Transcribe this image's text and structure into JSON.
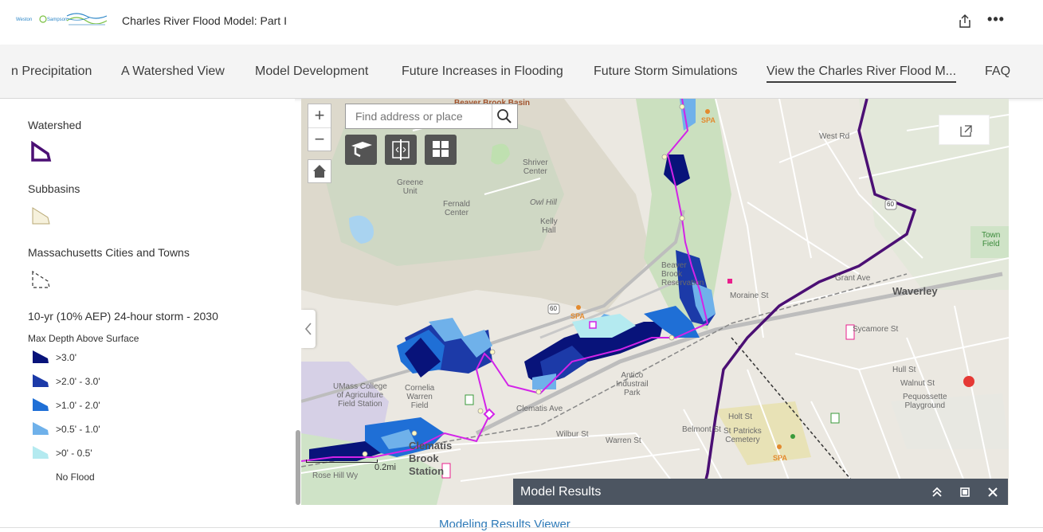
{
  "header": {
    "title": "Charles River Flood Model: Part I",
    "more_label": "•••"
  },
  "nav": {
    "items": [
      "n Precipitation",
      "A Watershed View",
      "Model Development",
      "Future Increases in Flooding",
      "Future Storm Simulations",
      "View the Charles River Flood M...",
      "FAQ"
    ],
    "active_index": 5
  },
  "legend": {
    "watershed": "Watershed",
    "subbasins": "Subbasins",
    "towns": "Massachusetts Cities and Towns",
    "storm_title": "10-yr (10% AEP) 24-hour storm - 2030",
    "depth_title": "Max Depth Above Surface",
    "classes": [
      {
        "label": ">3.0'",
        "color": "#08137a"
      },
      {
        "label": ">2.0' - 3.0'",
        "color": "#1c3aa8"
      },
      {
        "label": ">1.0' - 2.0'",
        "color": "#1f6fd6"
      },
      {
        "label": ">0.5' - 1.0'",
        "color": "#6fb1ea"
      },
      {
        "label": ">0' - 0.5'",
        "color": "#b4eaf0"
      },
      {
        "label": "No Flood",
        "color": ""
      }
    ]
  },
  "map": {
    "search_placeholder": "Find address or place",
    "scale_label": "0.2mi",
    "labels": {
      "beaver_brook_basin": "Beaver Brook Basin",
      "shriver": "Shriver\nCenter",
      "greene": "Greene\nUnit",
      "fernald": "Fernald\nCenter",
      "owl_hill": "Owl Hill",
      "kelly": "Kelly\nHall",
      "waverley": "Waverley",
      "antico": "Antico\nIndustrail\nPark",
      "umass": "UMass College\nof Agriculture\nField Station",
      "cornelia": "Cornelia\nWarren\nField",
      "clematis": "Clematis\nBrook\nStation",
      "pequossette": "Pequossette\nPlayground",
      "st_patricks": "St Patricks\nCemetery",
      "town_field": "Town\nField",
      "beaver_brook_res": "Beaver\nBrook\nReservation",
      "grant_ave": "Grant Ave",
      "west_rd": "West Rd",
      "moraine": "Moraine St",
      "clematis_ave": "Clematis Ave",
      "wilbur": "Wilbur St",
      "warren": "Warren St",
      "belmont": "Belmont St",
      "holt": "Holt St",
      "sycamore": "Sycamore St",
      "hull": "Hull St",
      "walnut": "Walnut St",
      "rose_hill": "Rose Hill Wy",
      "spa1": "SPA",
      "spa2": "SPA",
      "spa3": "SPA",
      "n60a": "60",
      "n60b": "60"
    },
    "colors": {
      "watershed": "#4b0f74",
      "stream": "#d323e8",
      "depth3": "#08137a",
      "depth2": "#1c3aa8",
      "depth1": "#1f6fd6",
      "depth05": "#6fb1ea",
      "depth0": "#b4eaf0"
    }
  },
  "results": {
    "title": "Model Results"
  },
  "footer": {
    "link": "Modeling Results Viewer"
  }
}
